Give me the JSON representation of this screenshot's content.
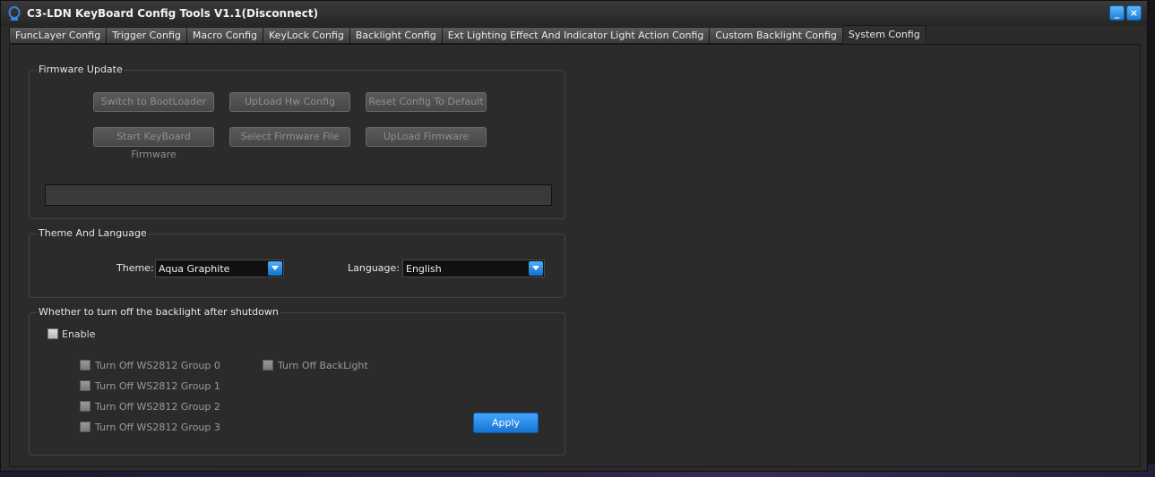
{
  "window": {
    "title": "C3-LDN KeyBoard Config Tools V1.1(Disconnect)",
    "minimize_label": "_",
    "close_label": "×"
  },
  "tabs": [
    {
      "label": "FuncLayer Config"
    },
    {
      "label": "Trigger Config"
    },
    {
      "label": "Macro Config"
    },
    {
      "label": "KeyLock Config"
    },
    {
      "label": "Backlight Config"
    },
    {
      "label": "Ext Lighting Effect And Indicator Light Action Config"
    },
    {
      "label": "Custom Backlight Config"
    },
    {
      "label": "System Config",
      "active": true
    }
  ],
  "firmware": {
    "group_title": "Firmware Update",
    "buttons": {
      "switch_bootloader": "Switch to BootLoader",
      "upload_hw_config": "UpLoad Hw Config",
      "reset_config": "Reset Config To Default",
      "start_firmware": "Start KeyBoard Firmware",
      "select_firmware": "Select Firmware File",
      "upload_firmware": "UpLoad Firmware"
    }
  },
  "theme_language": {
    "group_title": "Theme And Language",
    "theme_label": "Theme:",
    "theme_value": "Aqua Graphite",
    "language_label": "Language:",
    "language_value": "English"
  },
  "backlight_shutdown": {
    "group_title": "Whether to turn off the backlight after shutdown",
    "enable_label": "Enable",
    "options": {
      "group0": "Turn Off WS2812 Group 0",
      "group1": "Turn Off WS2812 Group 1",
      "group2": "Turn Off WS2812 Group 2",
      "group3": "Turn Off WS2812 Group 3",
      "backlight": "Turn Off BackLight"
    },
    "apply_label": "Apply"
  },
  "colors": {
    "accent": "#1a7fd6",
    "panel": "#2b2b2b"
  }
}
